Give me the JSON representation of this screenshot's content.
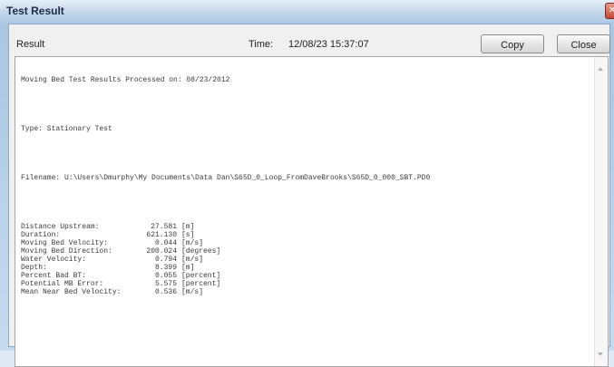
{
  "window": {
    "title": "Test Result",
    "close_glyph": "✕"
  },
  "header": {
    "result_label": "Result",
    "time_label": "Time:",
    "time_value": "12/08/23 15:37:07",
    "copy_label": "Copy",
    "close_label": "Close"
  },
  "results": {
    "processed_line": "Moving Bed Test Results Processed on: 08/23/2012",
    "type_line": "Type: Stationary Test",
    "filename_line": "Filename: U:\\Users\\Dmurphy\\My Documents\\Data Dan\\S65D_0_Loop_FromDaveBrooks\\S65D_0_000_SBT.PD0",
    "stats": [
      {
        "label": "Distance Upstream:",
        "value": "27.581",
        "unit": "[m]"
      },
      {
        "label": "Duration:",
        "value": "621.130",
        "unit": "[s]"
      },
      {
        "label": "Moving Bed Velocity:",
        "value": "0.044",
        "unit": "[m/s]"
      },
      {
        "label": "Moving Bed Direction:",
        "value": "200.024",
        "unit": "[degrees]"
      },
      {
        "label": "Water Velocity:",
        "value": "0.794",
        "unit": "[m/s]"
      },
      {
        "label": "Depth:",
        "value": "8.399",
        "unit": "[m]"
      },
      {
        "label": "Percent Bad BT:",
        "value": "0.055",
        "unit": "[percent]"
      },
      {
        "label": "Potential MB Error:",
        "value": "5.575",
        "unit": "[percent]"
      },
      {
        "label": "Mean Near Bed Velocity:",
        "value": "0.536",
        "unit": "[m/s]"
      }
    ]
  }
}
